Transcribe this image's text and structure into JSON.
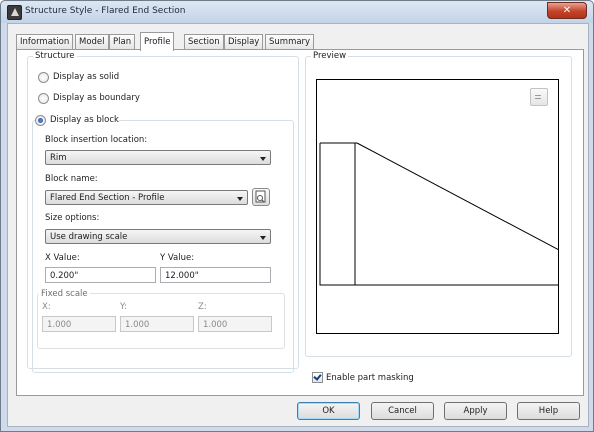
{
  "window": {
    "title": "Structure Style - Flared End Section",
    "close_glyph": "✕"
  },
  "tabs": [
    {
      "label": "Information",
      "active": false
    },
    {
      "label": "Model",
      "active": false
    },
    {
      "label": "Plan",
      "active": false
    },
    {
      "label": "Profile",
      "active": true
    },
    {
      "label": "Section",
      "active": false
    },
    {
      "label": "Display",
      "active": false
    },
    {
      "label": "Summary",
      "active": false
    }
  ],
  "structure": {
    "group_label": "Structure",
    "options": [
      {
        "label": "Display as solid",
        "selected": false
      },
      {
        "label": "Display as boundary",
        "selected": false
      },
      {
        "label": "Display as block",
        "selected": true
      }
    ],
    "insertion_label": "Block insertion location:",
    "insertion_value": "Rim",
    "block_name_label": "Block name:",
    "block_name_value": "Flared End Section - Profile",
    "size_options_label": "Size options:",
    "size_options_value": "Use drawing scale",
    "x_value_label": "X Value:",
    "x_value": "0.200\"",
    "y_value_label": "Y Value:",
    "y_value": "12.000\"",
    "fixed_scale": {
      "group_label": "Fixed scale",
      "x_label": "X:",
      "x_value": "1.000",
      "y_label": "Y:",
      "y_value": "1.000",
      "z_label": "Z:",
      "z_value": "1.000"
    }
  },
  "preview": {
    "group_label": "Preview",
    "enable_masking_label": "Enable part masking",
    "enable_masking_checked": true
  },
  "buttons": {
    "ok": "OK",
    "cancel": "Cancel",
    "apply": "Apply",
    "help": "Help"
  },
  "icons": [
    "app-icon",
    "close-icon",
    "dropdown-arrow-icon",
    "block-browse-icon",
    "preview-view-icon"
  ]
}
